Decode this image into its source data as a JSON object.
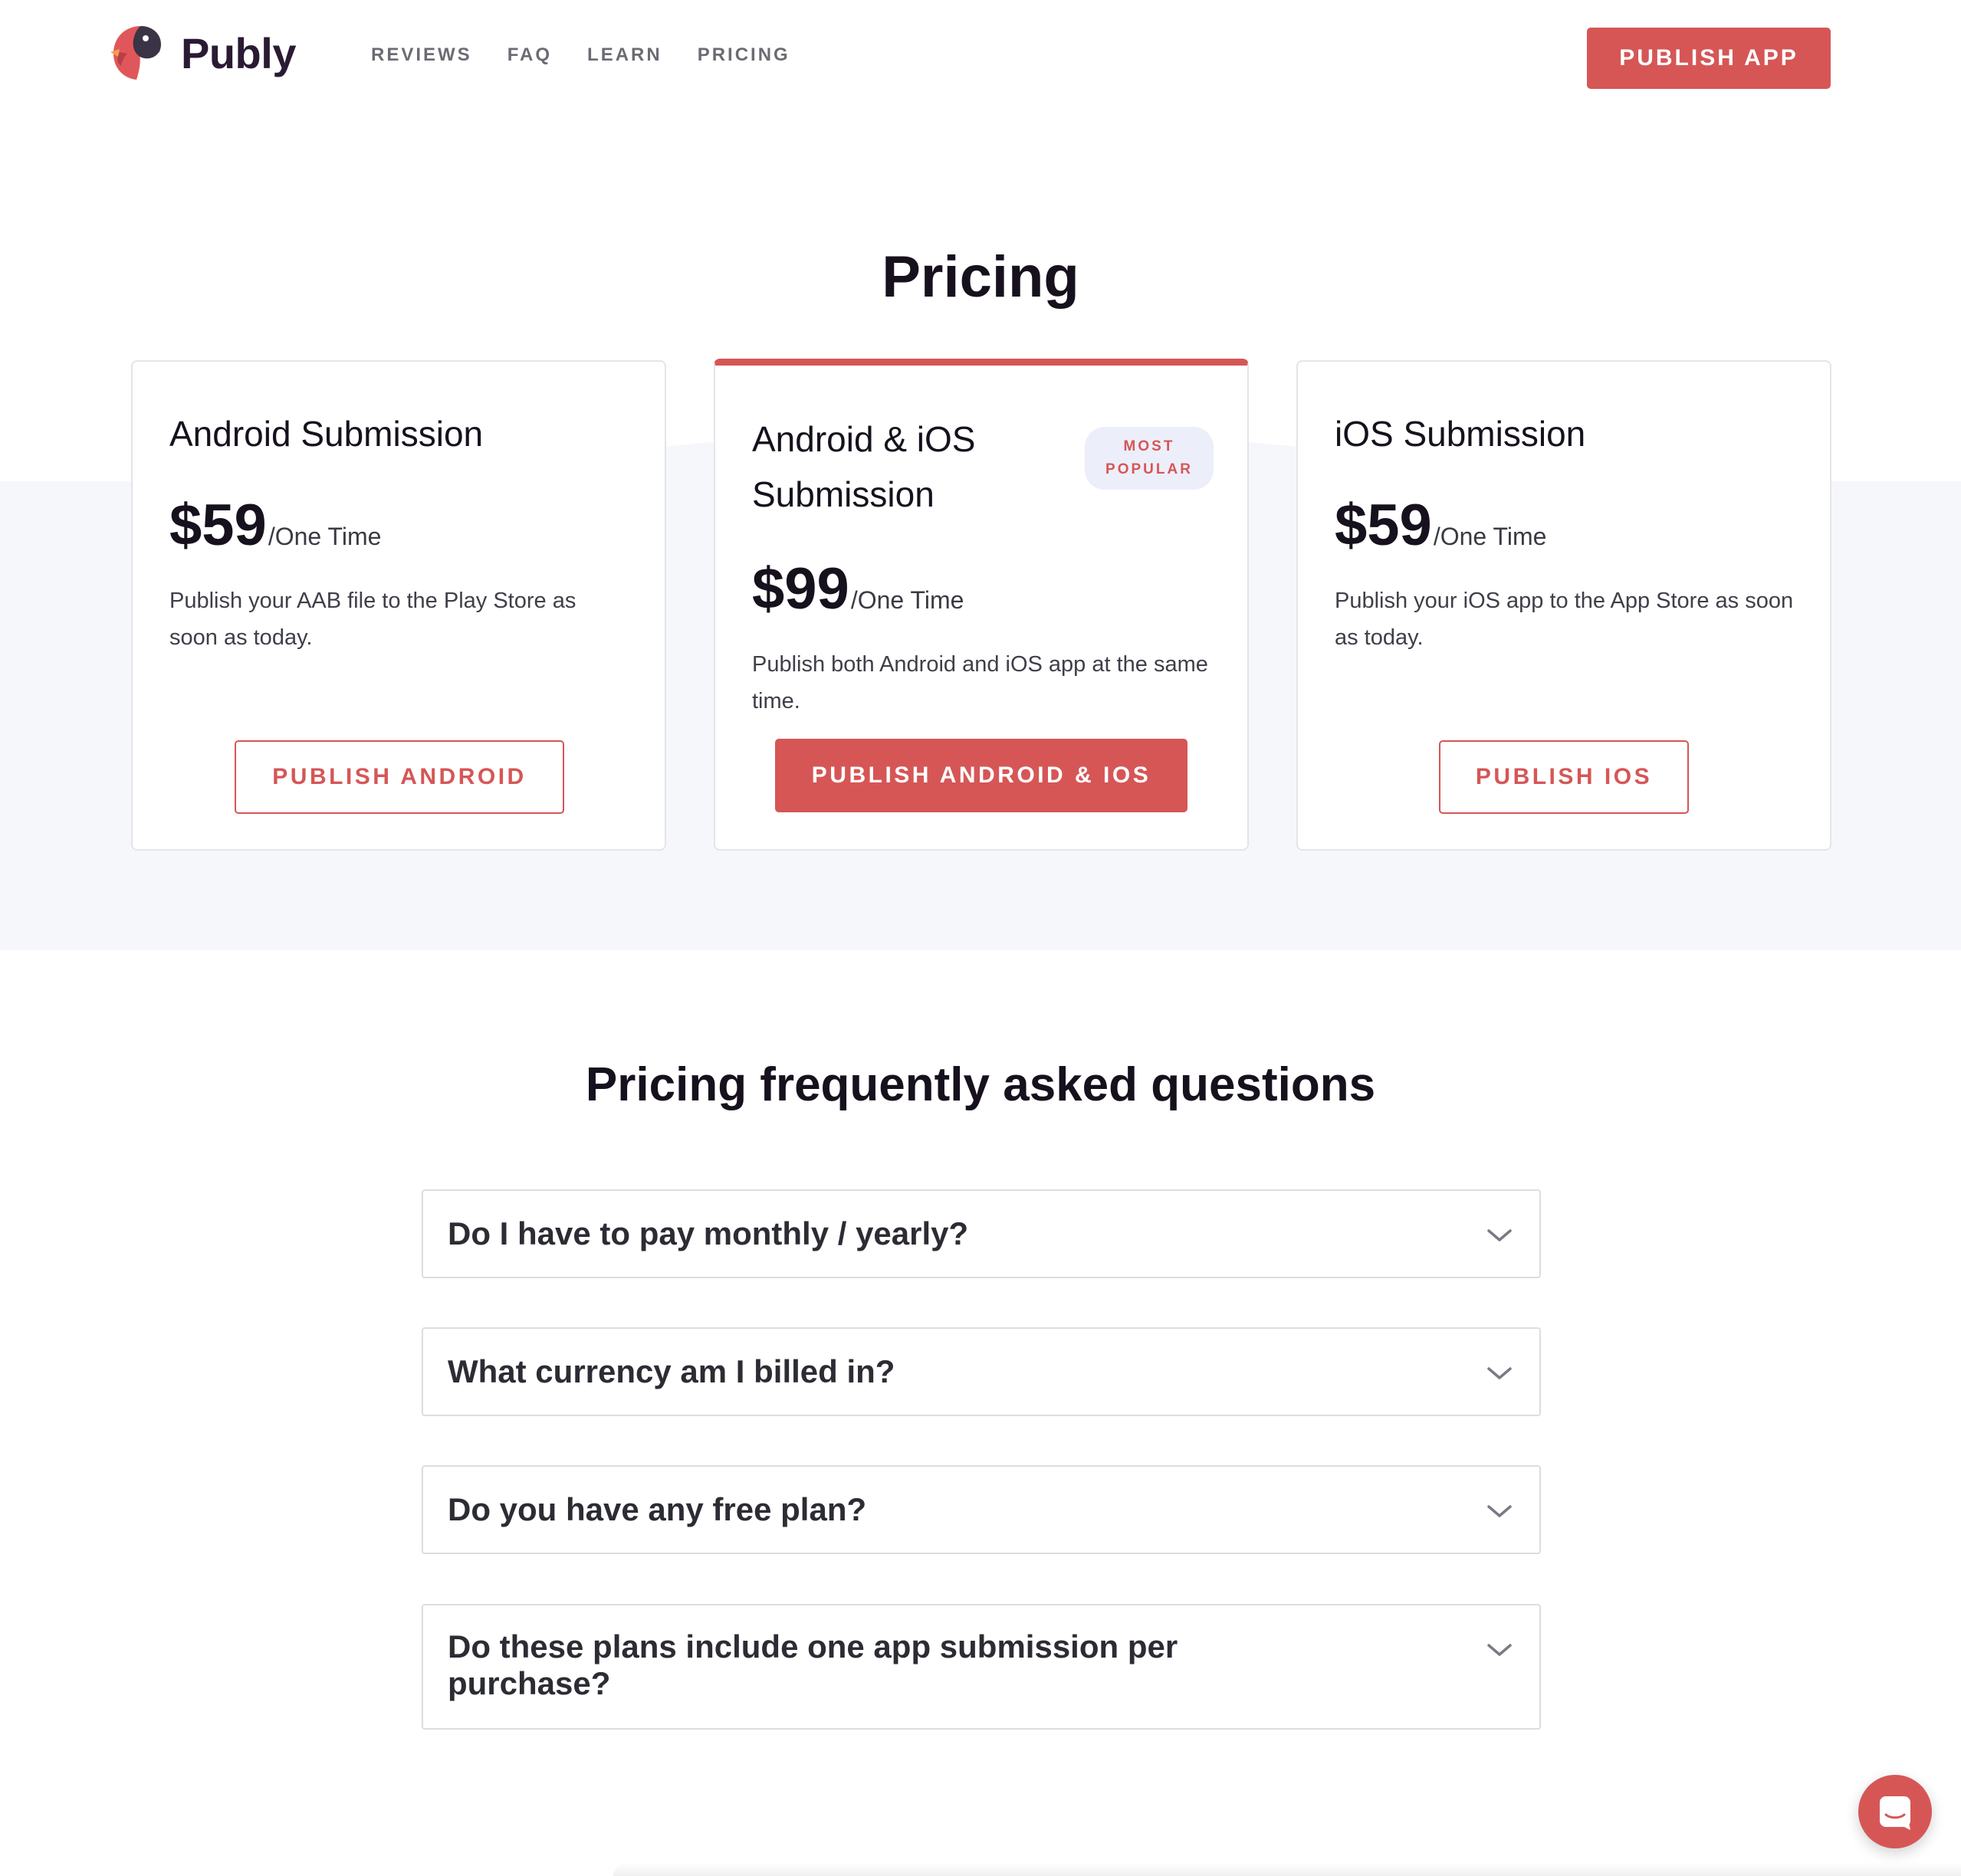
{
  "header": {
    "brand": "Publy",
    "nav": [
      "REVIEWS",
      "FAQ",
      "LEARN",
      "PRICING"
    ],
    "cta": "PUBLISH APP"
  },
  "pricing": {
    "title": "Pricing",
    "plans": [
      {
        "title": "Android Submission",
        "price": "$59",
        "period": "/One Time",
        "description": "Publish your AAB file to the Play Store as soon as today.",
        "button": "PUBLISH ANDROID"
      },
      {
        "title": "Android & iOS Submission",
        "badge": "MOST POPULAR",
        "price": "$99",
        "period": "/One Time",
        "description": "Publish both Android and iOS app at the same time.",
        "button": "PUBLISH ANDROID & IOS"
      },
      {
        "title": "iOS Submission",
        "price": "$59",
        "period": "/One Time",
        "description": "Publish your iOS app to the App Store as soon as today.",
        "button": "PUBLISH IOS"
      }
    ]
  },
  "faq": {
    "title": "Pricing frequently asked questions",
    "items": [
      "Do I have to pay monthly / yearly?",
      "What currency am I billed in?",
      "Do you have any free plan?",
      "Do these plans include one app submission per purchase?"
    ]
  },
  "colors": {
    "accent": "#d65656",
    "section_bg": "#f6f7fb",
    "badge_bg": "#eceffa",
    "text_dark": "#16111d"
  },
  "icons": [
    "parrot-logo-icon",
    "chevron-down-icon",
    "chat-icon"
  ]
}
